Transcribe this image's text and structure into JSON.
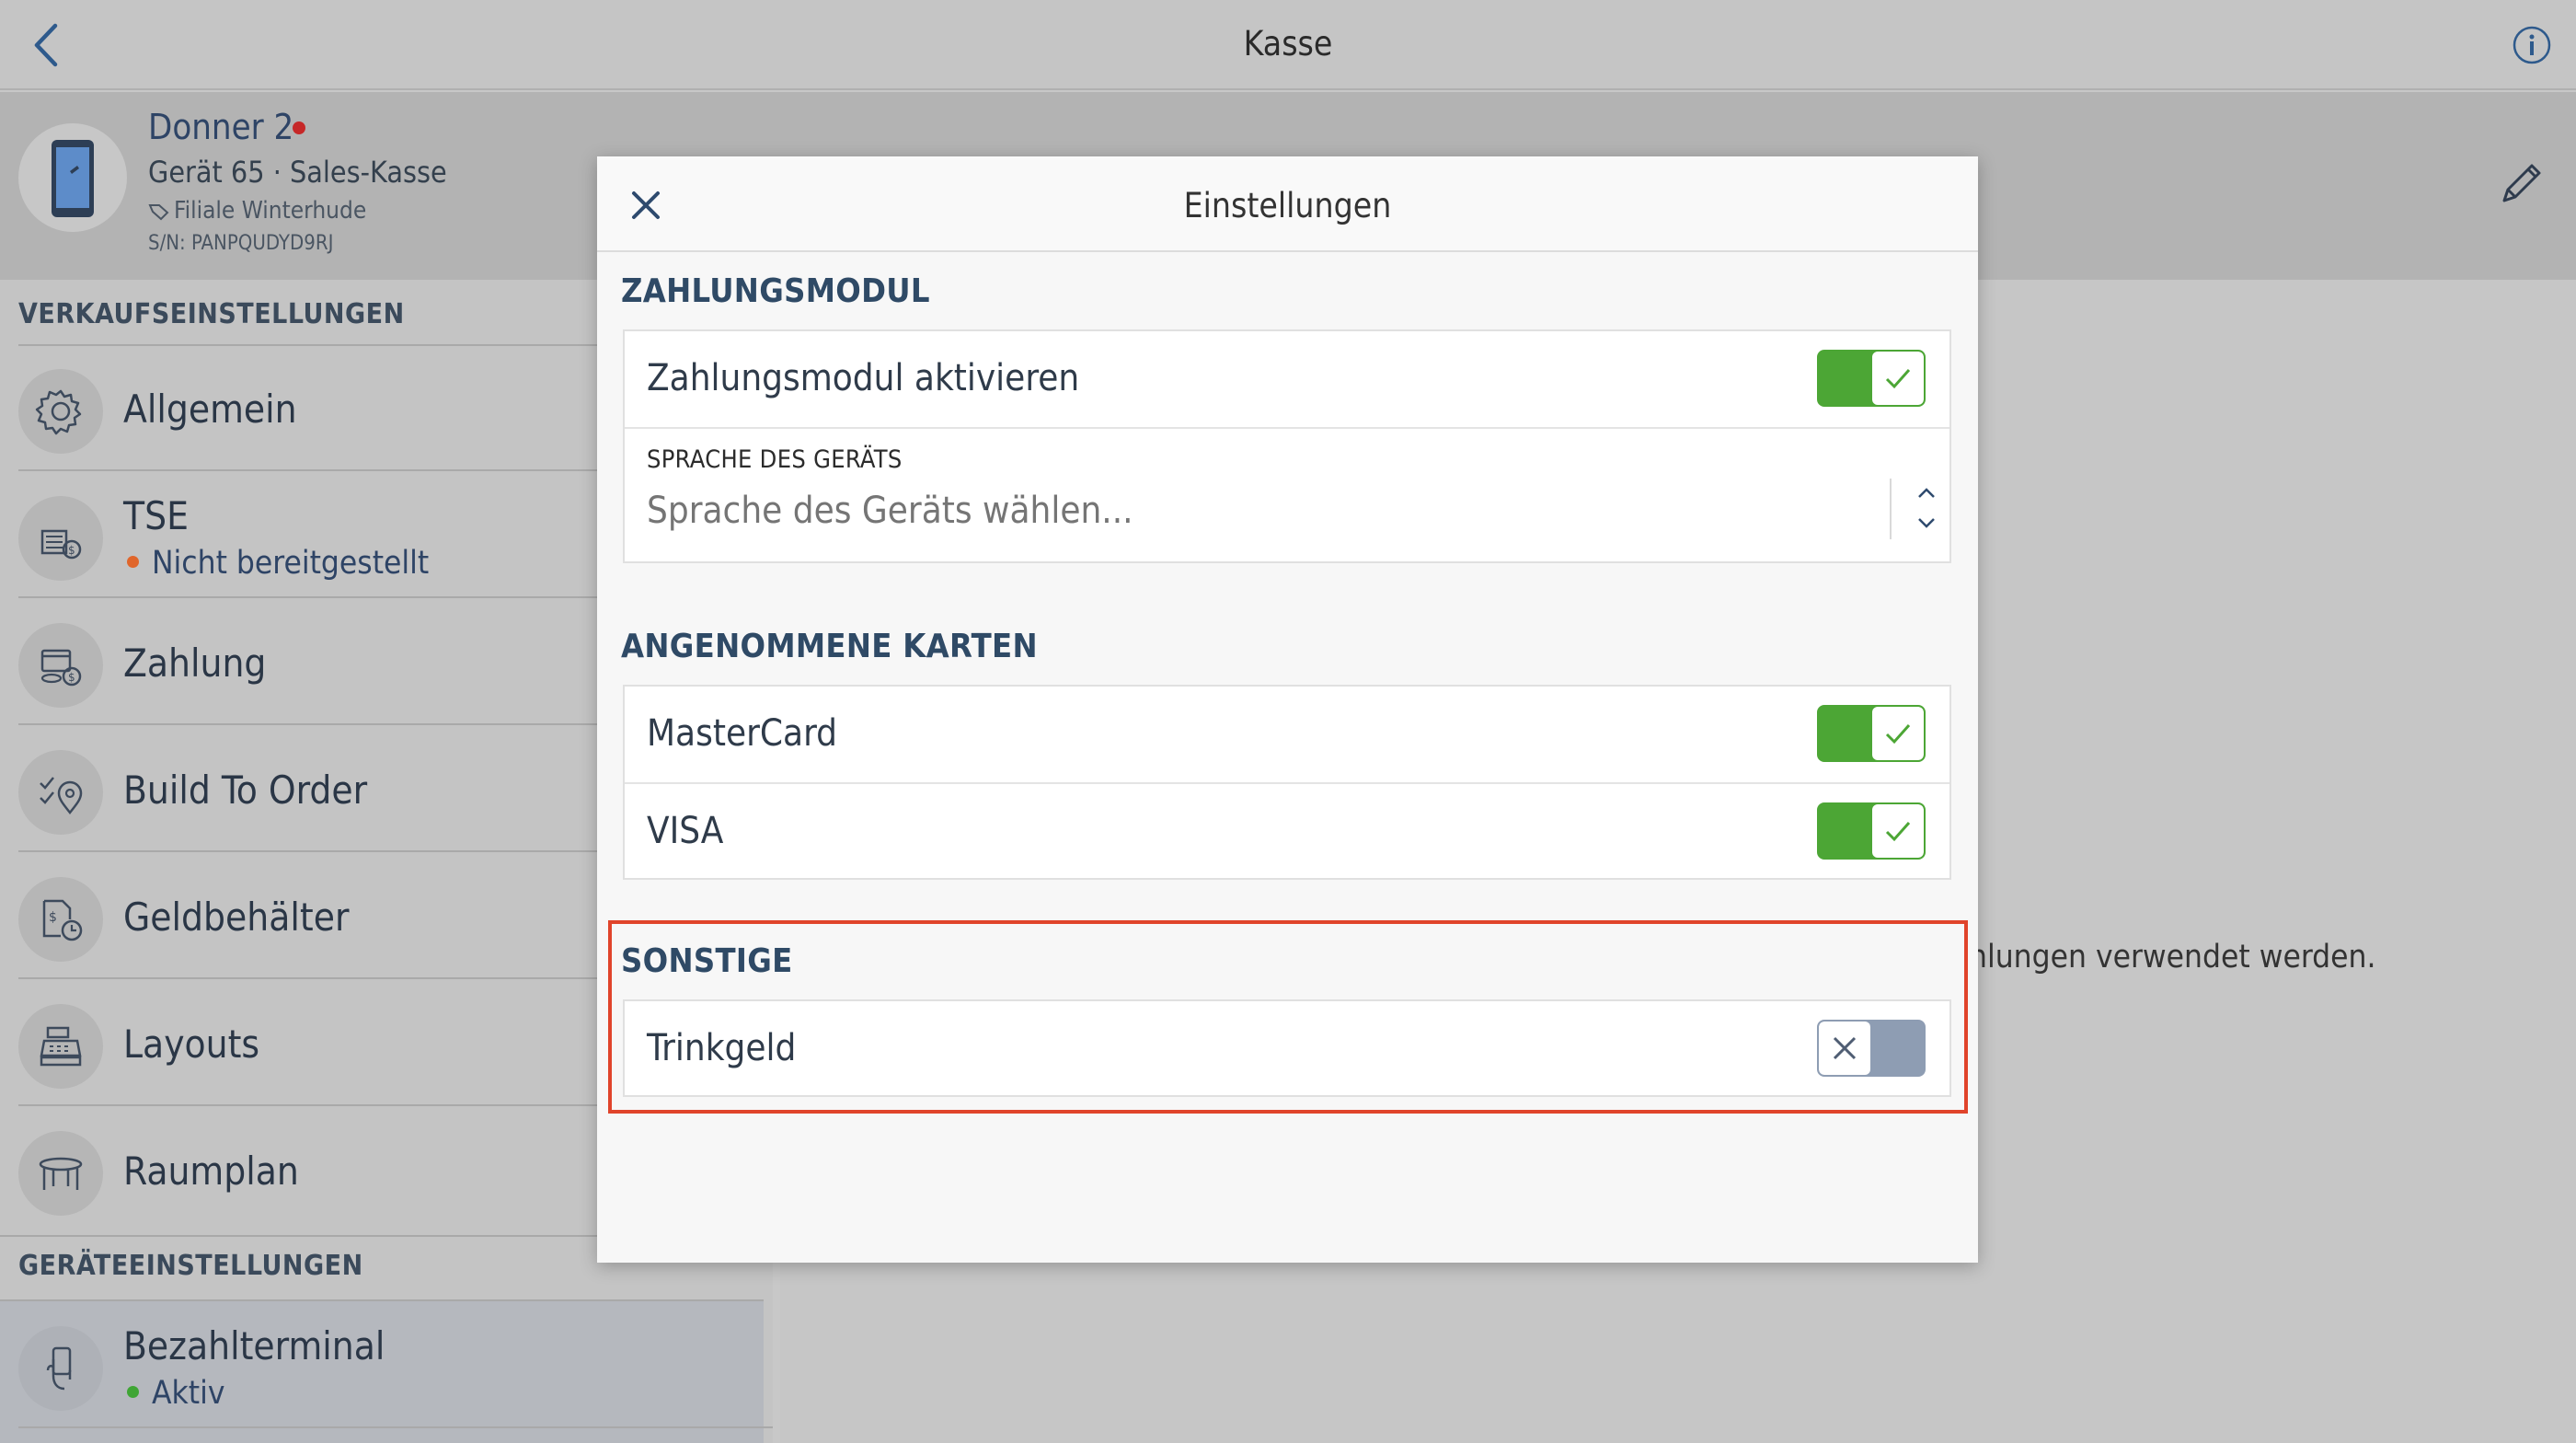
{
  "topbar": {
    "title": "Kasse"
  },
  "device": {
    "name": "Donner 2",
    "line2": "Gerät 65 · Sales-Kasse",
    "branch": "Filiale Winterhude",
    "serial": "S/N: PANPQUDYD9RJ",
    "status_color": "#c62828"
  },
  "sidebar": {
    "section_sales": "VERKAUFSEINSTELLUNGEN",
    "section_device": "GERÄTEEINSTELLUNGEN",
    "items": [
      {
        "label": "Allgemein",
        "icon": "gear-icon"
      },
      {
        "label": "TSE",
        "status": "Nicht bereitgestellt",
        "status_color": "#e0662b",
        "icon": "tse-icon"
      },
      {
        "label": "Zahlung",
        "icon": "payment-icon"
      },
      {
        "label": "Build To Order",
        "icon": "build-to-order-icon"
      },
      {
        "label": "Geldbehälter",
        "icon": "cash-drawer-icon"
      },
      {
        "label": "Layouts",
        "icon": "cash-register-icon"
      },
      {
        "label": "Raumplan",
        "icon": "table-icon"
      }
    ],
    "device_items": [
      {
        "label": "Bezahlterminal",
        "status": "Aktiv",
        "status_color": "#3fa535",
        "icon": "terminal-hand-icon"
      }
    ]
  },
  "background_text": "hlungen verwendet werden.",
  "modal": {
    "title": "Einstellungen",
    "section_payment": "ZAHLUNGSMODUL",
    "payment_toggle_label": "Zahlungsmodul aktivieren",
    "payment_toggle_on": true,
    "language_label": "SPRACHE DES GERÄTS",
    "language_placeholder": "Sprache des Geräts wählen...",
    "section_cards": "ANGENOMMENE KARTEN",
    "cards": [
      {
        "label": "MasterCard",
        "on": true
      },
      {
        "label": "VISA",
        "on": true
      }
    ],
    "section_other": "SONSTIGE",
    "tip_label": "Trinkgeld",
    "tip_on": false
  },
  "colors": {
    "toggle_on": "#4ca635",
    "toggle_off": "#8e9db3",
    "highlight": "#e0442b"
  }
}
